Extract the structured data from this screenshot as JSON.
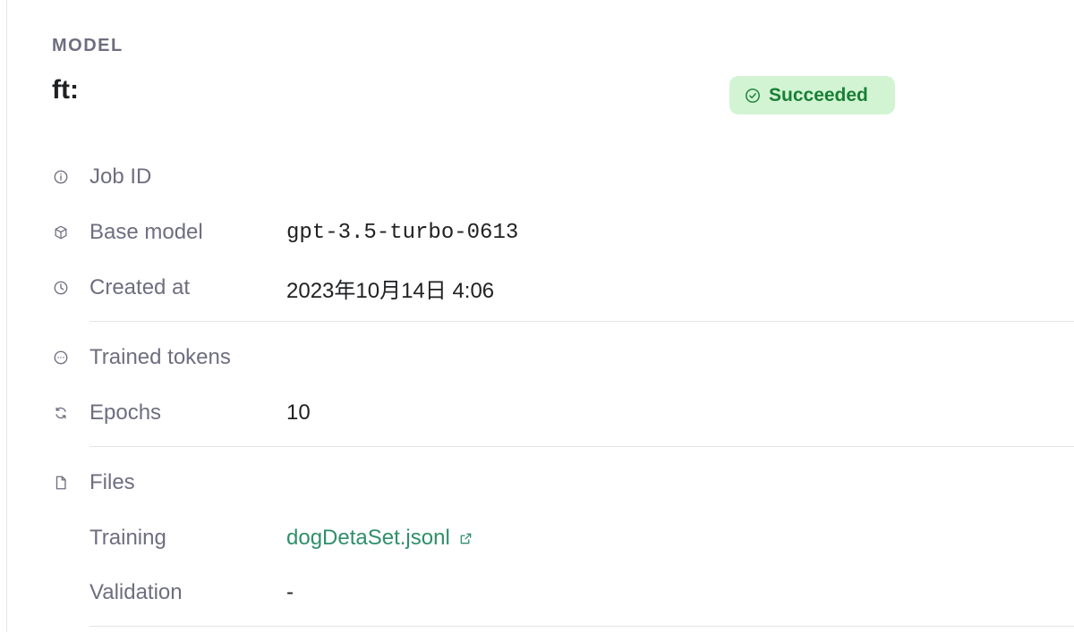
{
  "header": {
    "section_label": "MODEL",
    "model_name": "ft:",
    "status": {
      "label": "Succeeded",
      "icon": "check-circle-icon",
      "color": "#1a7f37",
      "background": "#d2f4d3"
    }
  },
  "details": {
    "job_id": {
      "label": "Job ID",
      "icon": "info-icon",
      "value": ""
    },
    "base_model": {
      "label": "Base model",
      "icon": "cube-icon",
      "value": "gpt-3.5-turbo-0613"
    },
    "created_at": {
      "label": "Created at",
      "icon": "clock-icon",
      "value": "2023年10月14日 4:06"
    },
    "trained_tokens": {
      "label": "Trained tokens",
      "icon": "ellipsis-circle-icon",
      "value": ""
    },
    "epochs": {
      "label": "Epochs",
      "icon": "refresh-icon",
      "value": "10"
    },
    "files": {
      "label": "Files",
      "icon": "file-icon",
      "training": {
        "label": "Training",
        "value": "dogDetaSet.jsonl",
        "icon": "external-link-icon"
      },
      "validation": {
        "label": "Validation",
        "value": "-"
      }
    }
  },
  "colors": {
    "link": "#2f8f6a",
    "muted": "#6e6e80",
    "text": "#202123"
  }
}
